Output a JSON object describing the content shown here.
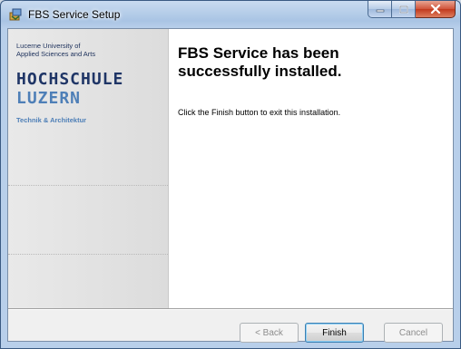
{
  "window": {
    "title": "FBS Service Setup",
    "caption_buttons": [
      "minimize",
      "maximize",
      "close"
    ]
  },
  "branding": {
    "university_line1": "Lucerne University of",
    "university_line2": "Applied Sciences and Arts",
    "logo_line1": "HOCHSCHULE",
    "logo_line2": "LUZERN",
    "department": "Technik & Architektur",
    "colors": {
      "navy": "#1f3566",
      "blue": "#4e7fb7"
    }
  },
  "content": {
    "heading_line1": "FBS Service has been",
    "heading_line2": "successfully installed.",
    "instruction": "Click the Finish button to exit this installation."
  },
  "buttons": {
    "back": "< Back",
    "finish": "Finish",
    "cancel": "Cancel"
  },
  "icons": {
    "app": "installer-icon",
    "minimize": "minimize-icon",
    "maximize": "maximize-icon",
    "close": "close-icon"
  }
}
